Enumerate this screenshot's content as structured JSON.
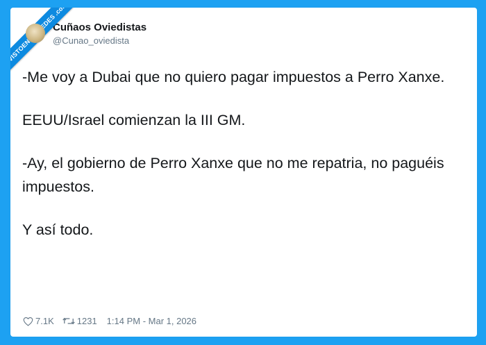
{
  "watermark": {
    "text": "VISTOENLASREDES .com"
  },
  "tweet": {
    "author_name": "Cuñaos Oviedistas",
    "author_handle": "@Cunao_oviedista",
    "paragraphs": [
      "-Me voy a Dubai que no quiero pagar impuestos a Perro Xanxe.",
      "EEUU/Israel comienzan la III GM.",
      "-Ay, el gobierno de Perro Xanxe que no me repatria, no paguéis impuestos.",
      "Y así todo."
    ],
    "likes": "7.1K",
    "retweets": "1231",
    "timestamp": "1:14 PM - Mar 1, 2026"
  },
  "colors": {
    "background": "#1da1f2",
    "ribbon": "#0d8ae0",
    "text": "#14171a",
    "muted": "#657786"
  },
  "icons": [
    "heart-icon",
    "retweet-icon"
  ]
}
